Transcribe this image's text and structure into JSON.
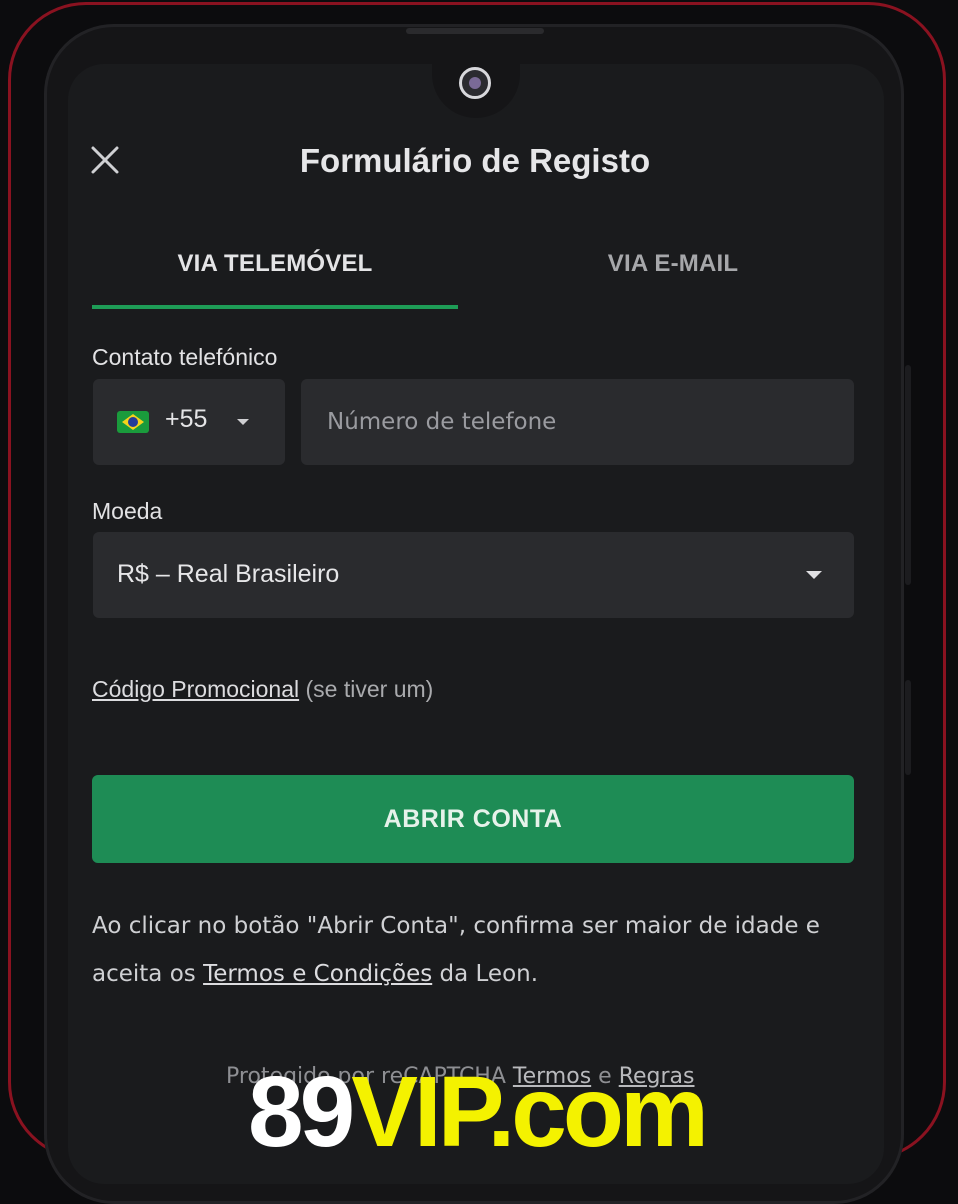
{
  "header": {
    "title": "Formulário de Registo"
  },
  "tabs": [
    {
      "label": "VIA TELEMÓVEL",
      "active": true
    },
    {
      "label": "VIA E-MAIL",
      "active": false
    }
  ],
  "phone": {
    "label": "Contato telefónico",
    "country_code": "+55",
    "country_flag": "brazil-flag-icon",
    "placeholder": "Número de telefone",
    "value": ""
  },
  "currency": {
    "label": "Moeda",
    "selected": "R$ – Real Brasileiro"
  },
  "promo": {
    "link_label": "Código Promocional",
    "hint": "(se tiver um)"
  },
  "cta": {
    "label": "ABRIR CONTA"
  },
  "terms": {
    "text_before": "Ao clicar no botão \"Abrir Conta\", confirma ser maior de idade e aceita os ",
    "link_label": "Termos e Condições",
    "text_after": " da Leon."
  },
  "footer": {
    "text_before": "Protegido por reCAPTCHA",
    "link_terms": "Termos",
    "connector": "e",
    "link_rules": "Regras"
  },
  "watermark": {
    "part1": "89",
    "part2": "VIP.com"
  },
  "colors": {
    "accent_green": "#1e8c55",
    "tab_underline": "#1e9d57",
    "frame_border": "#8a1220",
    "watermark_yellow": "#f4f200"
  }
}
